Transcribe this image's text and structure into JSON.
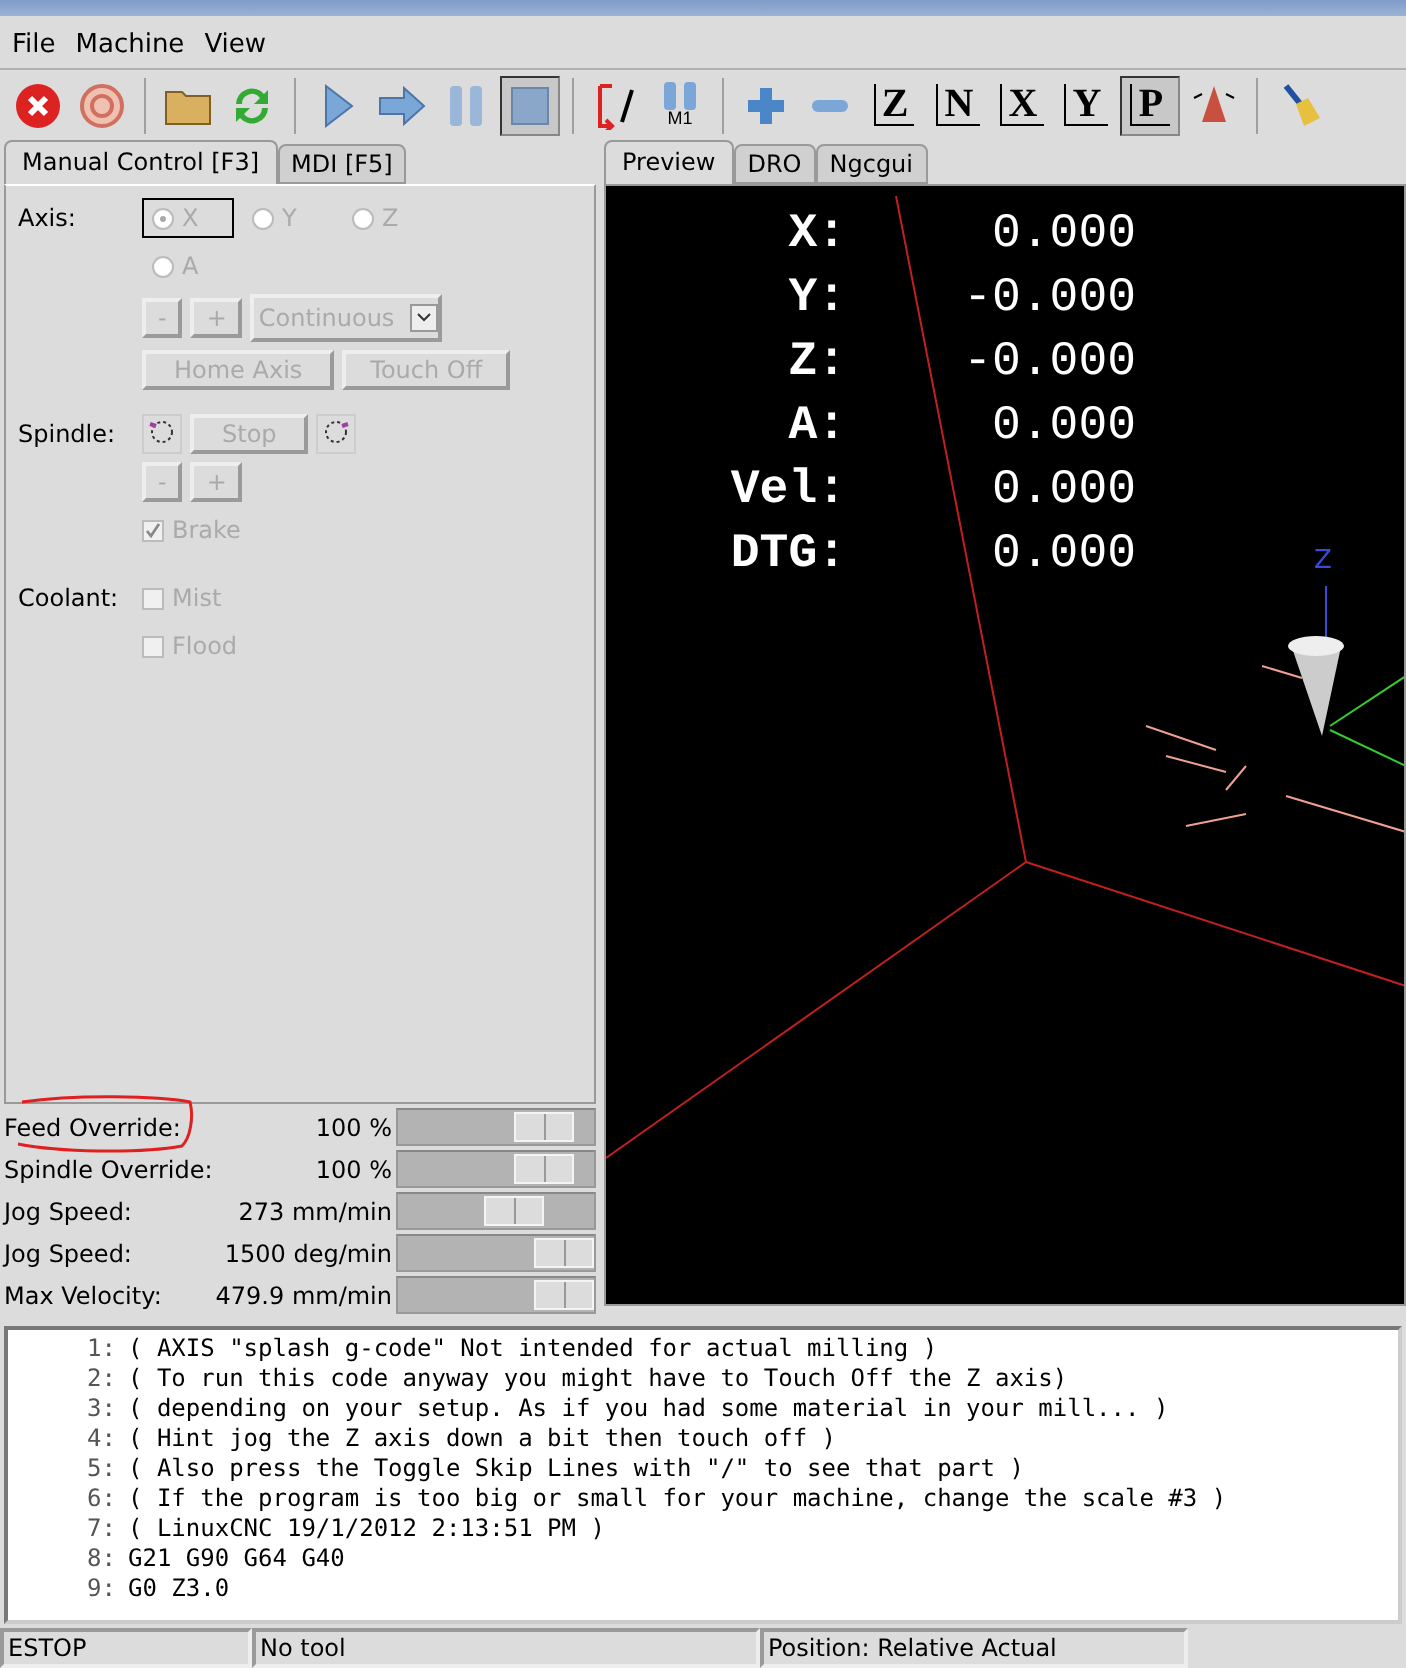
{
  "menu": [
    "File",
    "Machine",
    "View"
  ],
  "toolbar": [
    {
      "kind": "estop",
      "selected": false
    },
    {
      "kind": "power",
      "selected": false
    },
    {
      "kind": "sep"
    },
    {
      "kind": "open",
      "selected": false
    },
    {
      "kind": "reload",
      "selected": false
    },
    {
      "kind": "sep"
    },
    {
      "kind": "run",
      "selected": false
    },
    {
      "kind": "step",
      "selected": false
    },
    {
      "kind": "pause",
      "selected": false
    },
    {
      "kind": "stop",
      "selected": true
    },
    {
      "kind": "sep"
    },
    {
      "kind": "skip",
      "selected": false
    },
    {
      "kind": "optstop",
      "label": "M1",
      "selected": false
    },
    {
      "kind": "sep"
    },
    {
      "kind": "zoomin",
      "selected": false
    },
    {
      "kind": "zoomout",
      "selected": false
    },
    {
      "kind": "view",
      "label": "Z",
      "selected": false
    },
    {
      "kind": "view",
      "label": "N",
      "selected": false
    },
    {
      "kind": "view",
      "label": "X",
      "selected": false
    },
    {
      "kind": "view",
      "label": "Y",
      "selected": false
    },
    {
      "kind": "view",
      "label": "P",
      "selected": true
    },
    {
      "kind": "rotate",
      "selected": false
    },
    {
      "kind": "sep"
    },
    {
      "kind": "clear",
      "selected": false
    }
  ],
  "left_tabs": [
    {
      "label": "Manual Control [F3]",
      "selected": true
    },
    {
      "label": "MDI [F5]",
      "selected": false
    }
  ],
  "manual": {
    "axis_label": "Axis:",
    "axes": [
      {
        "label": "X",
        "selected": true
      },
      {
        "label": "Y",
        "selected": false
      },
      {
        "label": "Z",
        "selected": false
      },
      {
        "label": "A",
        "selected": false
      }
    ],
    "jog_minus": "-",
    "jog_plus": "+",
    "jog_mode": "Continuous",
    "home": "Home Axis",
    "touch_off": "Touch Off",
    "spindle_label": "Spindle:",
    "spindle_stop": "Stop",
    "spindle_minus": "-",
    "spindle_plus": "+",
    "brake": {
      "label": "Brake",
      "checked": true
    },
    "coolant_label": "Coolant:",
    "coolant": [
      {
        "label": "Mist",
        "checked": false
      },
      {
        "label": "Flood",
        "checked": false
      }
    ],
    "disabled": true
  },
  "sliders": [
    {
      "label": "Feed Override:",
      "reading": "100 %",
      "level": 0.85,
      "circled": true
    },
    {
      "label": "Spindle Override:",
      "reading": "100 %",
      "level": 0.85,
      "circled": false
    },
    {
      "label": "Jog Speed:",
      "reading": "273 mm/min",
      "level": 0.63,
      "circled": false
    },
    {
      "label": "Jog Speed:",
      "reading": "1500 deg/min",
      "level": 1.0,
      "circled": false
    },
    {
      "label": "Max Velocity:",
      "reading": "479.9 mm/min",
      "level": 1.0,
      "circled": false
    }
  ],
  "right_tabs": [
    {
      "label": "Preview",
      "selected": true
    },
    {
      "label": "DRO",
      "selected": false
    },
    {
      "label": "Ngcgui",
      "selected": false
    }
  ],
  "dro": [
    {
      "axis": "X:",
      "value": "0.000"
    },
    {
      "axis": "Y:",
      "value": "-0.000"
    },
    {
      "axis": "Z:",
      "value": "-0.000"
    },
    {
      "axis": "A:",
      "value": "0.000"
    },
    {
      "axis": "Vel:",
      "value": "0.000"
    },
    {
      "axis": "DTG:",
      "value": "0.000"
    }
  ],
  "preview_axis_label": "Z",
  "code": [
    {
      "n": "1:",
      "text": "( AXIS \"splash g-code\" Not intended for actual milling )"
    },
    {
      "n": "2:",
      "text": "( To run this code anyway you might have to Touch Off the Z axis)"
    },
    {
      "n": "3:",
      "text": "( depending on your setup. As if you had some material in your mill... )"
    },
    {
      "n": "4:",
      "text": "( Hint jog the Z axis down a bit then touch off )"
    },
    {
      "n": "5:",
      "text": "( Also press the Toggle Skip Lines with \"/\" to see that part )"
    },
    {
      "n": "6:",
      "text": "( If the program is too big or small for your machine, change the scale #3 )"
    },
    {
      "n": "7:",
      "text": "( LinuxCNC 19/1/2012 2:13:51 PM )"
    },
    {
      "n": "8:",
      "text": "G21 G90 G64 G40"
    },
    {
      "n": "9:",
      "text": "G0 Z3.0"
    }
  ],
  "status": [
    "ESTOP",
    "No tool",
    "Position: Relative Actual"
  ]
}
